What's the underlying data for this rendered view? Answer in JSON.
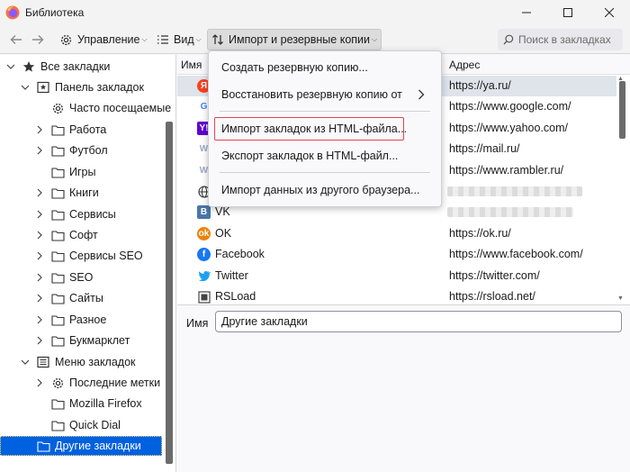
{
  "window": {
    "title": "Библиотека"
  },
  "toolbar": {
    "manage_label": "Управление",
    "view_label": "Вид",
    "import_label": "Импорт и резервные копии",
    "search_placeholder": "Поиск в закладках"
  },
  "sidebar": {
    "items": [
      {
        "label": "Все закладки",
        "icon": "star-icon",
        "expanded": true
      },
      {
        "label": "Панель закладок",
        "icon": "bookmarks-toolbar-icon",
        "expanded": true
      },
      {
        "label": "Часто посещаемые",
        "icon": "gear-icon"
      },
      {
        "label": "Работа",
        "icon": "folder-icon"
      },
      {
        "label": "Футбол",
        "icon": "folder-icon"
      },
      {
        "label": "Игры",
        "icon": "folder-icon"
      },
      {
        "label": "Книги",
        "icon": "folder-icon"
      },
      {
        "label": "Сервисы",
        "icon": "folder-icon"
      },
      {
        "label": "Софт",
        "icon": "folder-icon"
      },
      {
        "label": "Сервисы SEO",
        "icon": "folder-icon"
      },
      {
        "label": "SEO",
        "icon": "folder-icon"
      },
      {
        "label": "Сайты",
        "icon": "folder-icon"
      },
      {
        "label": "Разное",
        "icon": "folder-icon"
      },
      {
        "label": "Букмарклет",
        "icon": "folder-icon"
      },
      {
        "label": "Меню закладок",
        "icon": "bookmarks-menu-icon",
        "expanded": true
      },
      {
        "label": "Последние метки",
        "icon": "gear-icon"
      },
      {
        "label": "Mozilla Firefox",
        "icon": "folder-icon"
      },
      {
        "label": "Quick Dial",
        "icon": "folder-icon"
      },
      {
        "label": "Другие закладки",
        "icon": "folder-icon",
        "selected": true
      }
    ]
  },
  "table": {
    "headers": {
      "name": "Имя",
      "address": "Адрес"
    },
    "rows": [
      {
        "icon": "yandex-icon",
        "name": "",
        "url": "https://ya.ru/",
        "selected": true
      },
      {
        "icon": "google-icon",
        "name": "",
        "url": "https://www.google.com/"
      },
      {
        "icon": "yahoo-icon",
        "name": "",
        "url": "https://www.yahoo.com/"
      },
      {
        "icon": "mailru-icon",
        "name": "",
        "url": "https://mail.ru/"
      },
      {
        "icon": "rambler-icon",
        "name": "",
        "url": "https://www.rambler.ru/"
      },
      {
        "icon": "globe-icon",
        "name": "",
        "url": ""
      },
      {
        "icon": "vk-icon",
        "name": "VK",
        "url": ""
      },
      {
        "icon": "ok-icon",
        "name": "OK",
        "url": "https://ok.ru/"
      },
      {
        "icon": "facebook-icon",
        "name": "Facebook",
        "url": "https://www.facebook.com/"
      },
      {
        "icon": "twitter-icon",
        "name": "Twitter",
        "url": "https://twitter.com/"
      },
      {
        "icon": "rsload-icon",
        "name": "RSLoad",
        "url": "https://rsload.net/"
      }
    ]
  },
  "details": {
    "name_label": "Имя",
    "name_value": "Другие закладки"
  },
  "menu": {
    "items": [
      {
        "label": "Создать резервную копию..."
      },
      {
        "label": "Восстановить резервную копию от",
        "submenu": true
      },
      {
        "label": "Импорт закладок из HTML-файла...",
        "highlighted": true
      },
      {
        "label": "Экспорт закладок в HTML-файл..."
      },
      {
        "label": "Импорт данных из другого браузера..."
      }
    ]
  },
  "colors": {
    "accent": "#0061e0",
    "highlight_border": "#e0454c",
    "yandex": "#fc3f1d",
    "google_blue": "#4285f4",
    "yahoo": "#6001d2",
    "vk": "#4a76a8",
    "ok": "#ee8208",
    "facebook": "#1877f2",
    "twitter": "#1da1f2"
  }
}
